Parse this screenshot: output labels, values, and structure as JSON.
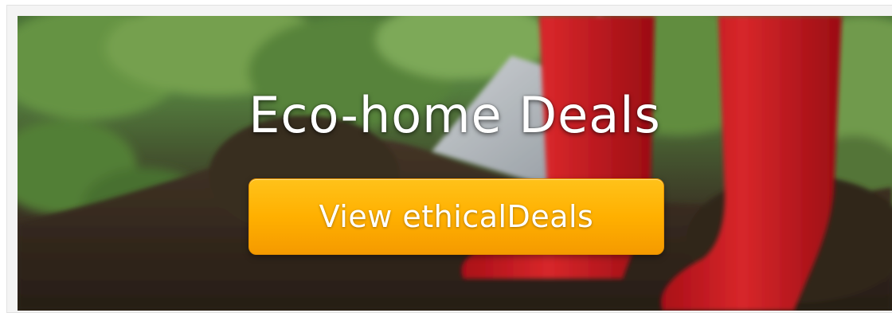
{
  "banner": {
    "headline": "Eco-home Deals",
    "cta_label": "View ethicalDeals",
    "background_image": "garden-spade-red-boots-photo",
    "colors": {
      "cta_top": "#ffc21a",
      "cta_bottom": "#f59a00",
      "boot_red": "#d81820",
      "headline_text": "#ffffff"
    }
  }
}
